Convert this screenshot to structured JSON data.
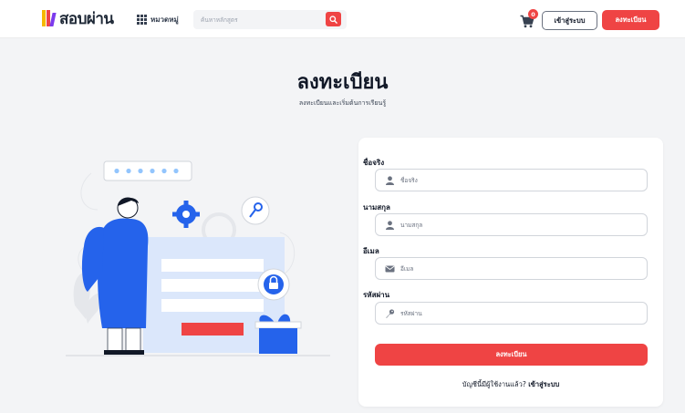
{
  "header": {
    "logo_text": "สอบผ่าน",
    "categories_label": "หมวดหมู่",
    "search_placeholder": "ค้นหาหลักสูตร",
    "cart_count": "0",
    "login_label": "เข้าสู่ระบบ",
    "register_label": "ลงทะเบียน"
  },
  "page": {
    "title": "ลงทะเบียน",
    "subtitle": "ลงทะเบียนและเริ่มต้นการเรียนรู้"
  },
  "form": {
    "first_name": {
      "label": "ชื่อจริง",
      "placeholder": "ชื่อจริง",
      "icon": "user-icon"
    },
    "last_name": {
      "label": "นามสกุล",
      "placeholder": "นามสกุล",
      "icon": "user-icon"
    },
    "email": {
      "label": "อีเมล",
      "placeholder": "อีเมล",
      "icon": "envelope-icon"
    },
    "password": {
      "label": "รหัสผ่าน",
      "placeholder": "รหัสผ่าน",
      "icon": "key-icon"
    },
    "submit_label": "ลงทะเบียน",
    "footer_question": "บัญชีนี้มีผู้ใช้งานแล้ว?",
    "footer_link": "เข้าสู่ระบบ"
  },
  "colors": {
    "accent": "#ef4444",
    "illustration_blue": "#2563eb",
    "illustration_light": "#dbe7fb"
  }
}
